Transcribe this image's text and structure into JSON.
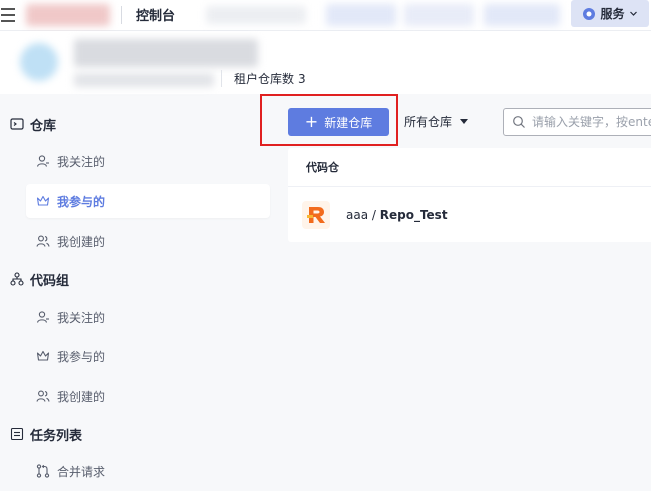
{
  "topbar": {
    "console_title": "控制台",
    "services_label": "服务"
  },
  "tenant": {
    "repo_count_label": "租户仓库数",
    "repo_count": "3"
  },
  "sidebar": {
    "groups": [
      {
        "label": "仓库",
        "items": [
          "我关注的",
          "我参与的",
          "我创建的"
        ]
      },
      {
        "label": "代码组",
        "items": [
          "我关注的",
          "我参与的",
          "我创建的"
        ]
      },
      {
        "label": "任务列表",
        "items": [
          "合并请求"
        ]
      }
    ]
  },
  "toolbar": {
    "new_repo_label": "新建仓库",
    "filter_label": "所有仓库",
    "search_placeholder": "请输入关键字，按enter"
  },
  "repo_list": {
    "heading": "代码仓",
    "rows": [
      {
        "owner": "aaa",
        "separator": " / ",
        "name": "Repo_Test"
      }
    ]
  },
  "colors": {
    "accent": "#5e7ce0",
    "highlight": "#e02020"
  }
}
